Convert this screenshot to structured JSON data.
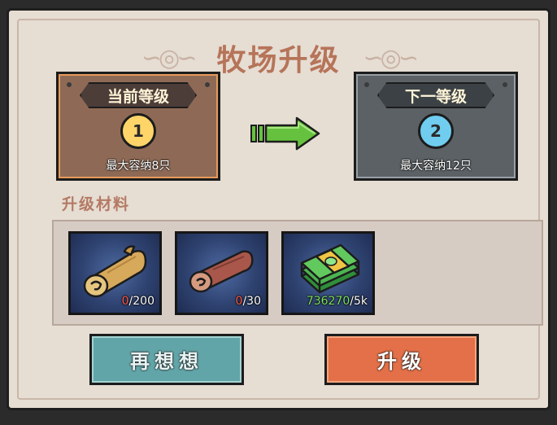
{
  "dialog": {
    "title": "牧场升级",
    "current_level": {
      "label": "当前等级",
      "level": "1",
      "capacity": "最大容纳8只"
    },
    "next_level": {
      "label": "下一等级",
      "level": "2",
      "capacity": "最大容纳12只"
    },
    "materials": {
      "label": "升级材料",
      "items": [
        {
          "icon": "light-log-icon",
          "have": "0",
          "need": "/200"
        },
        {
          "icon": "dark-log-icon",
          "have": "0",
          "need": "/30"
        },
        {
          "icon": "cash-stack-icon",
          "have": "736270",
          "need": "/5k"
        }
      ]
    },
    "buttons": {
      "cancel": "再想想",
      "confirm": "升级"
    }
  },
  "colors": {
    "background": "#e6ddd3",
    "title": "#b67459",
    "current_card": "#8e6a56",
    "next_card": "#5b6165",
    "cancel_button": "#62a5a8",
    "confirm_button": "#e37048",
    "insufficient": "#ff5b4c",
    "sufficient": "#7fe262"
  }
}
